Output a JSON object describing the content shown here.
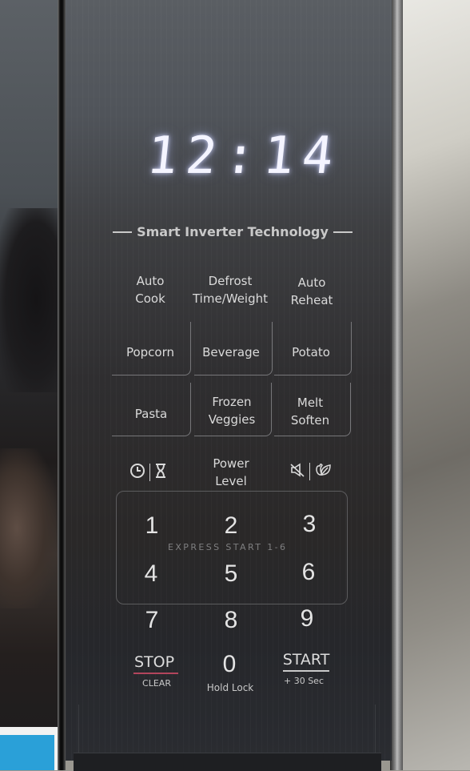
{
  "display": {
    "time": "12:14",
    "color": "#f4f4ff"
  },
  "branding": {
    "tagline": "Smart Inverter Technology"
  },
  "function_keys": [
    {
      "label_line1": "Auto",
      "label_line2": "Cook"
    },
    {
      "label_line1": "Defrost",
      "label_line2": "Time/Weight"
    },
    {
      "label_line1": "Auto",
      "label_line2": "Reheat"
    }
  ],
  "food_keys": [
    {
      "label_line1": "Popcorn",
      "label_line2": ""
    },
    {
      "label_line1": "Beverage",
      "label_line2": ""
    },
    {
      "label_line1": "Potato",
      "label_line2": ""
    },
    {
      "label_line1": "Pasta",
      "label_line2": ""
    },
    {
      "label_line1": "Frozen",
      "label_line2": "Veggies"
    },
    {
      "label_line1": "Melt",
      "label_line2": "Soften"
    }
  ],
  "control_row": {
    "left_icons": [
      "clock-icon",
      "hourglass-timer-icon"
    ],
    "power_level": {
      "line1": "Power",
      "line2": "Level"
    },
    "right_icons": [
      "mute-sound-icon",
      "eco-leaf-icon"
    ]
  },
  "numpad": {
    "digits": [
      "1",
      "2",
      "3",
      "4",
      "5",
      "6",
      "7",
      "8",
      "9",
      "0"
    ],
    "express_start": "EXPRESS START  1-6",
    "zero_sub": "Hold Lock"
  },
  "stop_key": {
    "label": "STOP",
    "sub": "CLEAR",
    "accent_color": "#b2455c"
  },
  "start_key": {
    "label": "START",
    "sub": "+ 30 Sec"
  }
}
